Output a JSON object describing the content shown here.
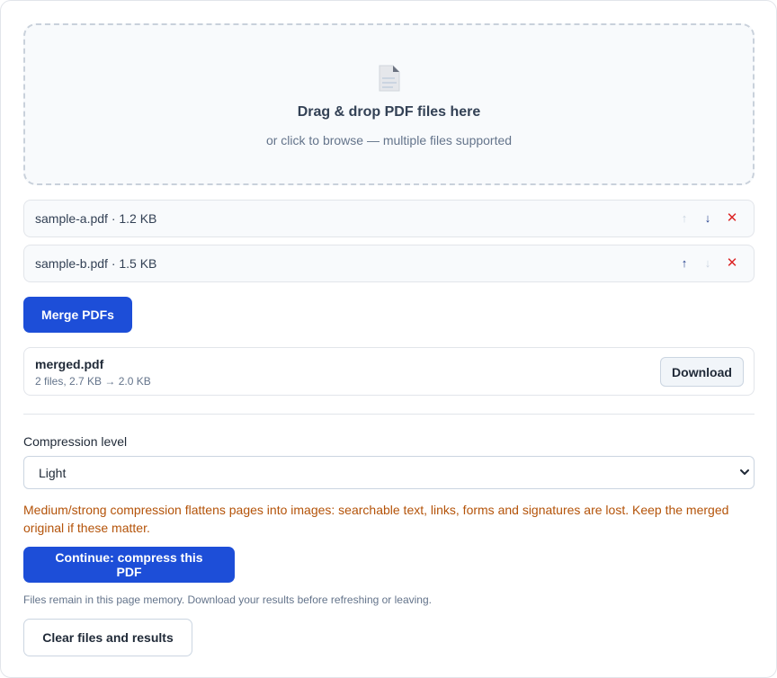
{
  "dropzone": {
    "title": "Drag & drop PDF files here",
    "subtitle": "or click to browse — multiple files supported",
    "icon": "document-icon"
  },
  "files": [
    {
      "label": "sample-a.pdf · 1.2 KB",
      "up": "↑",
      "down": "↓",
      "remove": "✕"
    },
    {
      "label": "sample-b.pdf · 1.5 KB",
      "up": "↑",
      "down": "↓",
      "remove": "✕"
    }
  ],
  "actions": {
    "merge_label": "Merge PDFs",
    "compress_label": "Continue: compress this PDF",
    "clear_label": "Clear files and results"
  },
  "result": {
    "name": "merged.pdf",
    "meta": "2 files, 2.7 KB → 2.0 KB",
    "download_label": "Download"
  },
  "compression": {
    "label": "Compression level",
    "selected": "Light"
  },
  "warning": "Medium/strong compression flattens pages into images: searchable text, links, forms and signatures are lost. Keep the merged original if these matter.",
  "note": "Files remain in this page memory. Download your results before refreshing or leaving.",
  "colors": {
    "primary": "#1d4ed8",
    "warning": "#b45309",
    "danger": "#dc2626"
  }
}
